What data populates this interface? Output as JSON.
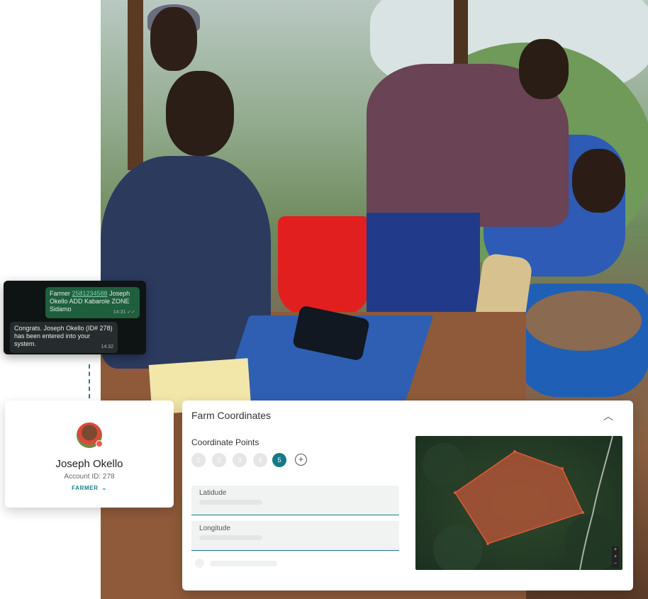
{
  "chat": {
    "outgoing": {
      "prefix": "Farmer ",
      "phone": "2581234588",
      "suffix": " Joseph Okello ADD Kabarole ZONE Sidamo",
      "time": "14:31"
    },
    "incoming": {
      "text": "Congrats. Joseph Okello (ID# 278) has been entered into your system.",
      "time": "14:32"
    }
  },
  "profile": {
    "name": "Joseph Okello",
    "account": "Account ID: 278",
    "role": "FARMER"
  },
  "farm": {
    "title": "Farm Coordinates",
    "points_label": "Coordinate Points",
    "points": [
      "1",
      "2",
      "3",
      "4",
      "5"
    ],
    "active_point": "5",
    "add_symbol": "+",
    "latitude_label": "Latidude",
    "longitude_label": "Longitude"
  },
  "map": {
    "zoom_controls": [
      "+",
      "+",
      "−"
    ],
    "polygon_color": "#e0573b"
  },
  "colors": {
    "accent": "#167a86",
    "chat_bg": "#0e1413",
    "chat_out": "#1f5f3e"
  }
}
